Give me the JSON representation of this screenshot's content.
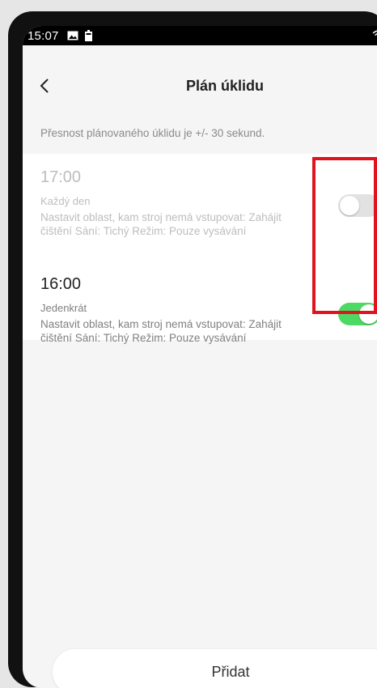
{
  "status_bar": {
    "time": "15:07"
  },
  "header": {
    "title": "Plán úklidu"
  },
  "notice": "Přesnost plánovaného úklidu je +/- 30 sekund.",
  "schedules": [
    {
      "time": "17:00",
      "frequency": "Každý den",
      "description": "Nastavit oblast, kam stroj nemá vstupovat: Zahájit čištění Sání: Tichý Režim: Pouze vysávání",
      "enabled": false
    },
    {
      "time": "16:00",
      "frequency": "Jedenkrát",
      "description": "Nastavit oblast, kam stroj nemá vstupovat: Zahájit čištění Sání: Tichý Režim: Pouze vysávání",
      "enabled": true
    }
  ],
  "footer": {
    "add_label": "Přidat"
  },
  "colors": {
    "toggle_on": "#4cd964",
    "toggle_off": "#e2e2e2",
    "highlight": "#e0141e"
  },
  "icons": [
    "back-chevron-icon",
    "image-icon",
    "battery-icon",
    "wifi-icon",
    "signal-icon"
  ]
}
